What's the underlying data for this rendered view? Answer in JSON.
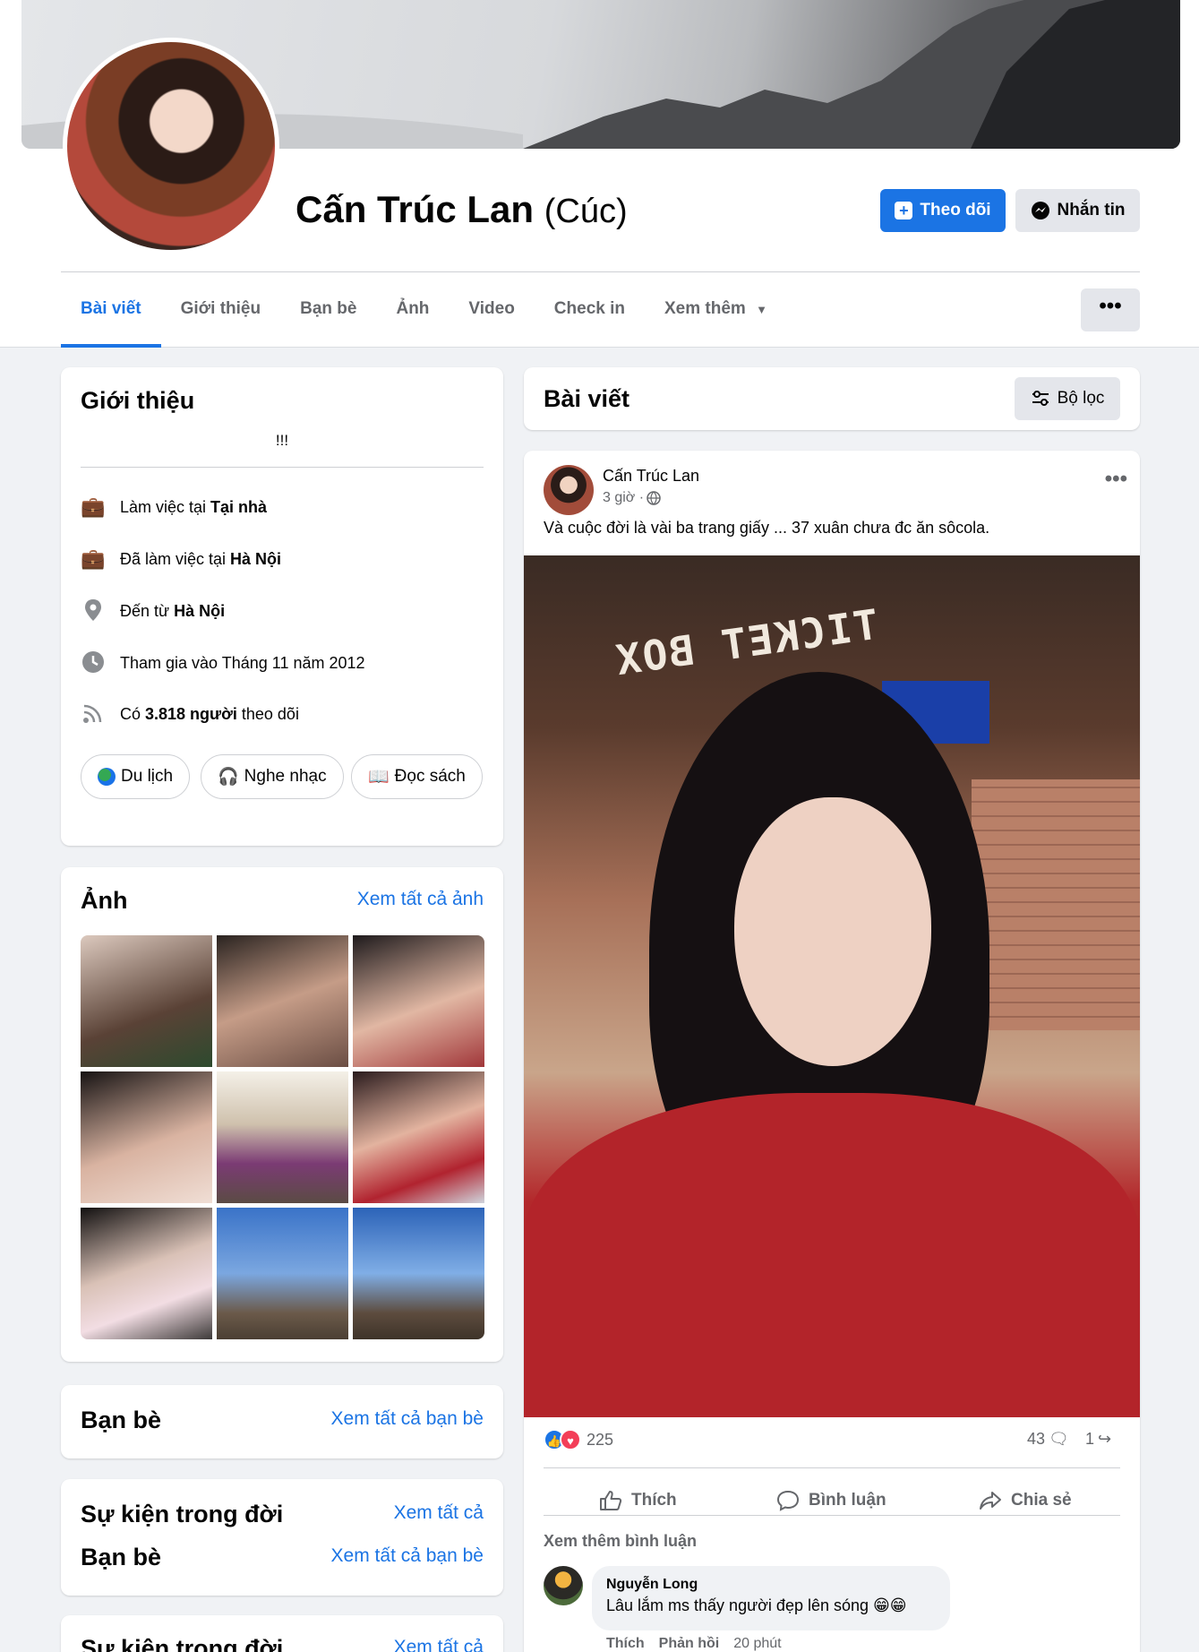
{
  "profile": {
    "name": "Cấn Trúc Lan",
    "nickname": "(Cúc)",
    "follow_label": "Theo dõi",
    "message_label": "Nhắn tin"
  },
  "tabs": [
    {
      "label": "Bài viết"
    },
    {
      "label": "Giới thiệu"
    },
    {
      "label": "Bạn bè"
    },
    {
      "label": "Ảnh"
    },
    {
      "label": "Video"
    },
    {
      "label": "Check in"
    },
    {
      "label": "Xem thêm"
    }
  ],
  "more_label": "•••",
  "intro": {
    "title": "Giới thiệu",
    "bio": "!!!",
    "rows": [
      {
        "prefix": "Làm việc tại ",
        "bold": "Tại nhà",
        "suffix": "",
        "icon": "briefcase-icon"
      },
      {
        "prefix": "Đã làm việc tại ",
        "bold": "Hà Nội",
        "suffix": "",
        "icon": "briefcase-icon"
      },
      {
        "prefix": "Đến từ ",
        "bold": "Hà Nội",
        "suffix": "",
        "icon": "location-pin-icon"
      },
      {
        "prefix": "Tham gia vào Tháng 11 năm 2012",
        "bold": "",
        "suffix": "",
        "icon": "clock-icon"
      },
      {
        "prefix": "Có ",
        "bold": "3.818 người",
        "suffix": " theo dõi",
        "icon": "rss-icon"
      }
    ],
    "hobbies": [
      "Du lịch",
      "Nghe nhạc",
      "Đọc sách"
    ]
  },
  "photos": {
    "title": "Ảnh",
    "see_all": "Xem tất cả ảnh"
  },
  "friends": {
    "title": "Bạn bè",
    "see_all": "Xem tất cả bạn bè"
  },
  "life_events": {
    "title": "Sự kiện trong đời",
    "see_all": "Xem tất cả",
    "friends_title": "Bạn bè",
    "friends_see_all": "Xem tất cả bạn bè"
  },
  "life_events_2": {
    "title": "Sự kiện trong đời",
    "see_all": "Xem tất cả"
  },
  "posts_header": {
    "title": "Bài viết",
    "filter_label": "Bộ lọc"
  },
  "post": {
    "author": "Cấn Trúc Lan",
    "time": "3 giờ · ",
    "text": "Và cuộc đời là vài ba trang giấy ... 37 xuân chưa đc ăn sôcola.",
    "photo_sign": "TICKET BOX",
    "reactions_count": "225",
    "comments_count": "43",
    "shares_count": "1",
    "like_label": "Thích",
    "comment_label": "Bình luận",
    "share_label": "Chia sẻ",
    "more_comments": "Xem thêm bình luận"
  },
  "comment": {
    "author": "Nguyễn Long",
    "text": "Lâu lắm ms thấy người đẹp lên sóng 😁😁",
    "like": "Thích",
    "reply": "Phản hồi",
    "time": "20 phút"
  }
}
